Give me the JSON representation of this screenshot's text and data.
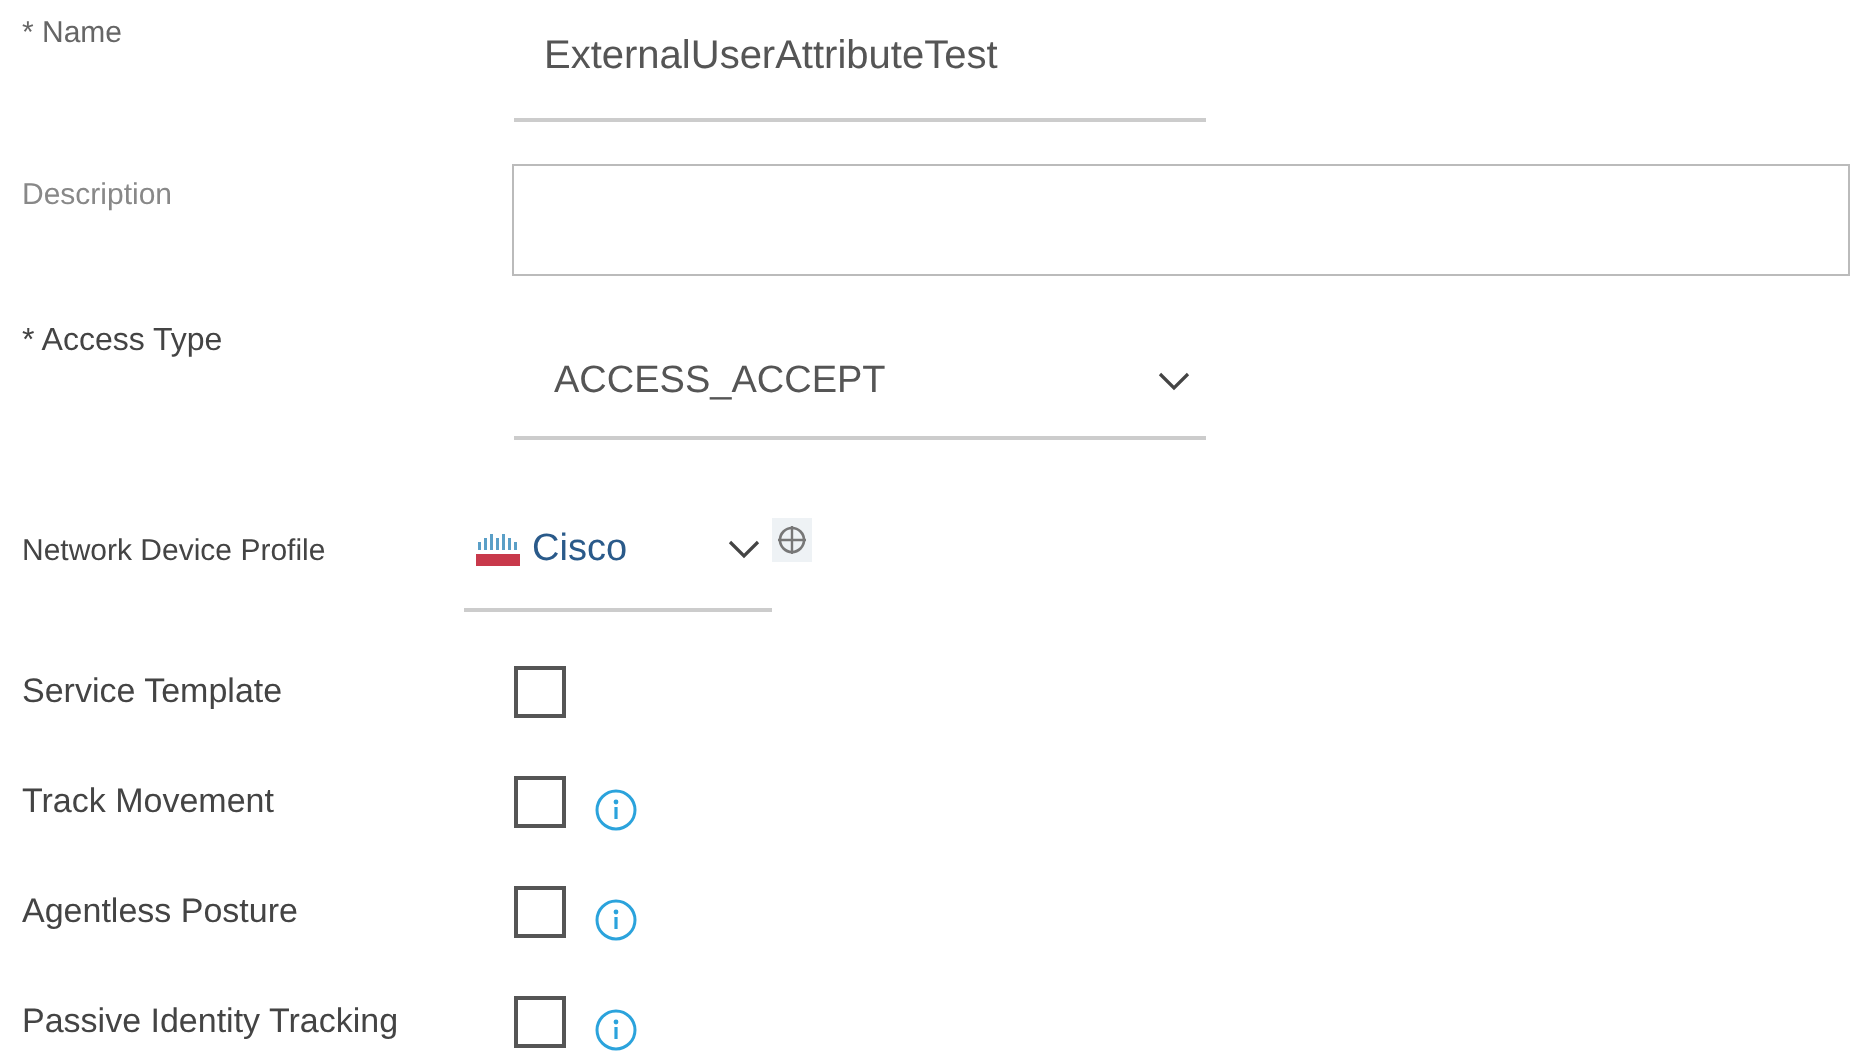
{
  "name": {
    "label": "* Name",
    "value": "ExternalUserAttributeTest"
  },
  "description": {
    "label": "Description"
  },
  "access_type": {
    "label": "* Access Type",
    "value": "ACCESS_ACCEPT"
  },
  "network_device_profile": {
    "label": "Network Device Profile",
    "value": "Cisco"
  },
  "options": [
    {
      "label": "Service Template",
      "checked": false,
      "info": false
    },
    {
      "label": "Track Movement",
      "checked": false,
      "info": true
    },
    {
      "label": "Agentless Posture",
      "checked": false,
      "info": true
    },
    {
      "label": "Passive Identity Tracking",
      "checked": false,
      "info": true
    }
  ]
}
